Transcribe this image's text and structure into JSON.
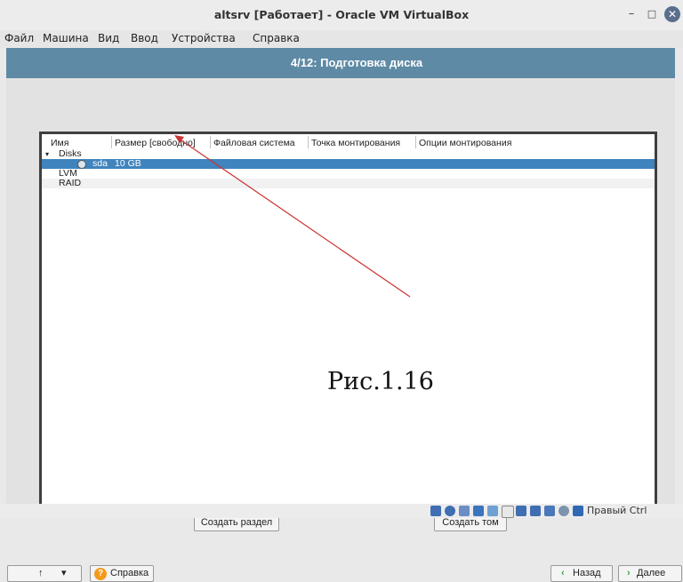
{
  "window": {
    "title": "altsrv [Работает] - Oracle VM VirtualBox"
  },
  "window_controls": {
    "minimize": "–",
    "maximize": "□",
    "close": "✕"
  },
  "menubar": [
    "Файл",
    "Машина",
    "Вид",
    "Ввод",
    "Устройства",
    "Справка"
  ],
  "installer": {
    "step_title": "4/12: Подготовка диска",
    "columns": [
      "Имя",
      "Размер [свободно]",
      "Файловая система",
      "Точка монтирования",
      "Опции монтирования"
    ],
    "tree": {
      "disks_label": "Disks",
      "disk_name": "sda",
      "disk_size": "10 GB",
      "lvm_label": "LVM",
      "raid_label": "RAID"
    },
    "buttons": {
      "create_partition": "Создать раздел",
      "create_volume": "Создать том"
    },
    "nav": {
      "up_arrow": "↑",
      "dropdown_arrow": "▾",
      "help_icon": "?",
      "help_label": "Справка",
      "back_label": "Назад",
      "next_label": "Далее"
    }
  },
  "annotation": {
    "caption": "Рис.1.16",
    "arrow_color": "#cc3333"
  },
  "statusbar": {
    "host_key": "Правый Ctrl"
  },
  "colors": {
    "selection": "#3f84bd",
    "vm_background": "#4f7d99",
    "header": "#5e8aa5"
  }
}
